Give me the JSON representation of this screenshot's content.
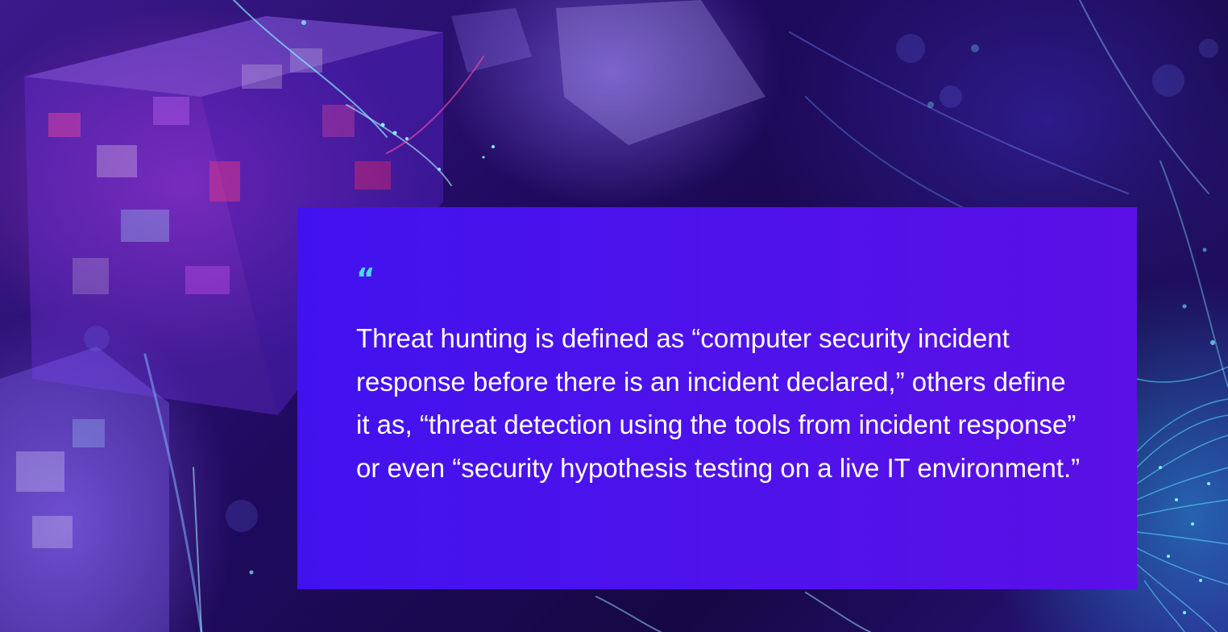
{
  "quote": {
    "mark": "“",
    "text": "Threat hunting is defined as “computer security incident response before there is an incident declared,” others define it as, “threat detection using the tools from incident response” or even “security hypothesis testing on a live IT environment.”"
  },
  "colors": {
    "card": "#4a12ec",
    "quote_mark": "#4fd7f2",
    "text": "#ffffff",
    "background": "#1f0a5e"
  }
}
